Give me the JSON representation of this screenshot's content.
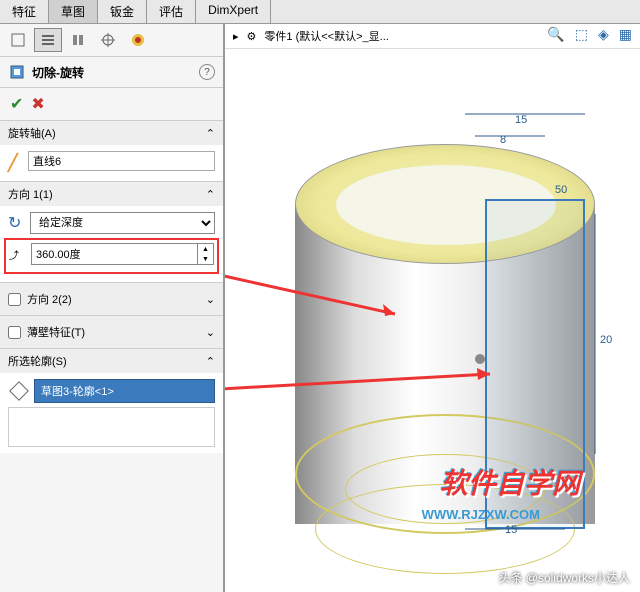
{
  "tabs": [
    "特征",
    "草图",
    "钣金",
    "评估",
    "DimXpert"
  ],
  "active_tab": 1,
  "breadcrumb": "零件1 (默认<<默认>_显...",
  "feature": {
    "title": "切除-旋转"
  },
  "sections": {
    "axis": {
      "title": "旋转轴(A)",
      "value": "直线6"
    },
    "dir1": {
      "title": "方向 1(1)",
      "type": "给定深度",
      "angle": "360.00度"
    },
    "dir2": {
      "title": "方向 2(2)"
    },
    "thin": {
      "title": "薄壁特征(T)"
    },
    "profile": {
      "title": "所选轮廓(S)",
      "value": "草图3-轮廓<1>"
    }
  },
  "dims": {
    "top1": "15",
    "top2": "8",
    "ang": "50",
    "side": "20",
    "bot": "15"
  },
  "watermark": "软件自学网",
  "watermark_url": "WWW.RJZXW.COM",
  "credit": "头条 @solidworks小达人"
}
